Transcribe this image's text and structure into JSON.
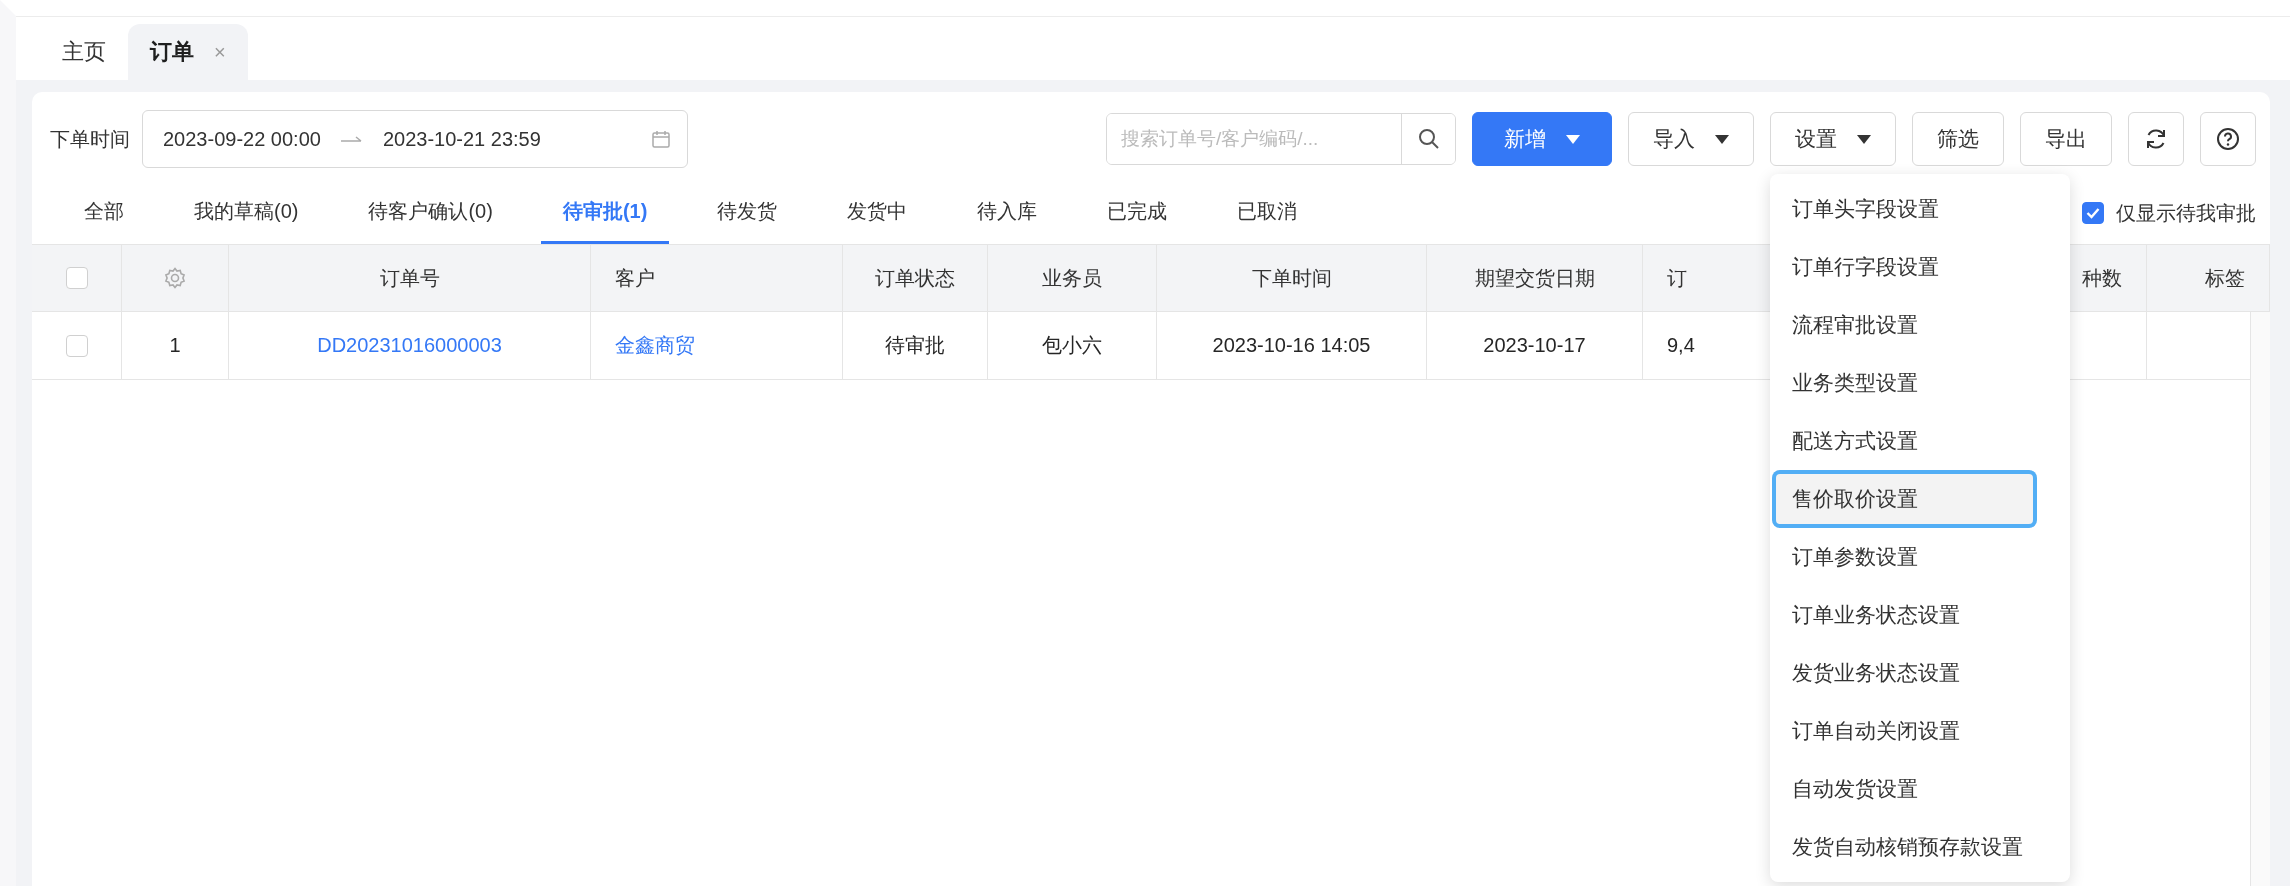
{
  "page_tabs": [
    {
      "label": "主页",
      "selected": false
    },
    {
      "label": "订单",
      "selected": true,
      "close_glyph": "×"
    }
  ],
  "filter": {
    "label": "下单时间",
    "start": "2023-09-22 00:00",
    "end": "2023-10-21 23:59"
  },
  "search": {
    "placeholder": "搜索订单号/客户编码/..."
  },
  "buttons": [
    {
      "label": "新增",
      "kind": "primary",
      "caret": true
    },
    {
      "label": "导入",
      "kind": "default",
      "caret": true
    },
    {
      "label": "设置",
      "kind": "default",
      "caret": true,
      "menu": true
    },
    {
      "label": "筛选",
      "kind": "default",
      "caret": false
    },
    {
      "label": "导出",
      "kind": "default",
      "caret": false
    }
  ],
  "status_tabs": [
    {
      "label": "全部",
      "selected": false
    },
    {
      "label": "我的草稿(0)",
      "selected": false
    },
    {
      "label": "待客户确认(0)",
      "selected": false
    },
    {
      "label": "待审批(1)",
      "selected": true
    },
    {
      "label": "待发货",
      "selected": false
    },
    {
      "label": "发货中",
      "selected": false
    },
    {
      "label": "待入库",
      "selected": false
    },
    {
      "label": "已完成",
      "selected": false
    },
    {
      "label": "已取消",
      "selected": false
    }
  ],
  "only_mine": {
    "label": "仅显示待我审批",
    "checked": true
  },
  "table": {
    "header_checked": false,
    "columns": [
      "订单号",
      "客户",
      "订单状态",
      "业务员",
      "下单时间",
      "期望交货日期",
      "订",
      "种数",
      "标签"
    ],
    "rows": [
      {
        "checked": false,
        "index": "1",
        "cells": [
          {
            "text": "DD20231016000003",
            "link": true
          },
          {
            "text": "金鑫商贸",
            "link": true
          },
          {
            "text": "待审批",
            "link": false
          },
          {
            "text": "包小六",
            "link": false
          },
          {
            "text": "2023-10-16 14:05",
            "link": false
          },
          {
            "text": "2023-10-17",
            "link": false
          },
          {
            "text": "9,4",
            "link": false
          }
        ]
      }
    ]
  },
  "settings_menu": {
    "items": [
      {
        "label": "订单头字段设置",
        "highlighted": false
      },
      {
        "label": "订单行字段设置",
        "highlighted": false
      },
      {
        "label": "流程审批设置",
        "highlighted": false
      },
      {
        "label": "业务类型设置",
        "highlighted": false
      },
      {
        "label": "配送方式设置",
        "highlighted": false
      },
      {
        "label": "售价取价设置",
        "highlighted": true
      },
      {
        "label": "订单参数设置",
        "highlighted": false
      },
      {
        "label": "订单业务状态设置",
        "highlighted": false
      },
      {
        "label": "发货业务状态设置",
        "highlighted": false
      },
      {
        "label": "订单自动关闭设置",
        "highlighted": false
      },
      {
        "label": "自动发货设置",
        "highlighted": false
      },
      {
        "label": "发货自动核销预存款设置",
        "highlighted": false
      }
    ]
  }
}
